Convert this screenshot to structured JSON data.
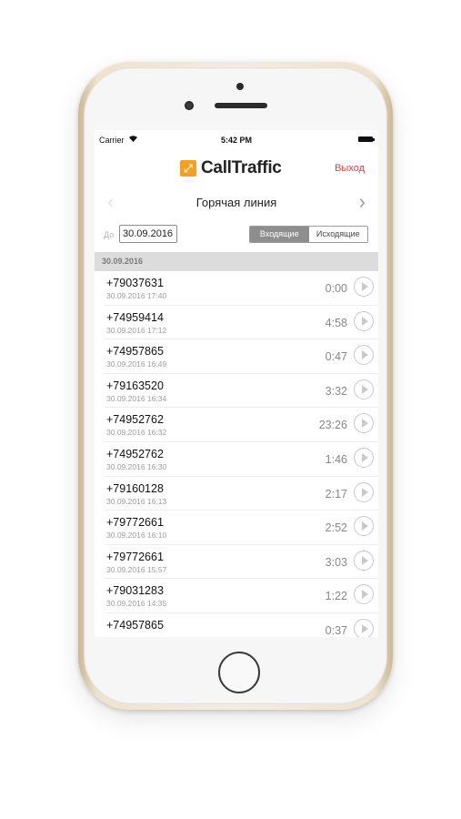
{
  "status_bar": {
    "carrier": "Carrier",
    "wifi_icon": "wifi-icon",
    "time": "5:42 PM",
    "battery_icon": "battery-icon"
  },
  "header": {
    "logo_text": "CallTraffic",
    "logo_color": "#f3a021",
    "logout_label": "Выход",
    "logout_color": "#e2413b"
  },
  "line_selector": {
    "title": "Горячая линия",
    "prev_icon": "chevron-left-icon",
    "next_icon": "chevron-right-icon"
  },
  "filter": {
    "date_prefix": "До",
    "date_value": "30.09.2016",
    "tabs": [
      {
        "label": "Входящие",
        "active": true
      },
      {
        "label": "Исходящие",
        "active": false
      }
    ]
  },
  "section": {
    "date": "30.09.2016"
  },
  "calls": [
    {
      "number": "+79037631",
      "datetime": "30.09.2016 17:40",
      "duration": "0:00"
    },
    {
      "number": "+74959414",
      "datetime": "30.09.2016 17:12",
      "duration": "4:58"
    },
    {
      "number": "+74957865",
      "datetime": "30.09.2016 16:49",
      "duration": "0:47"
    },
    {
      "number": "+79163520",
      "datetime": "30.09.2016 16:34",
      "duration": "3:32"
    },
    {
      "number": "+74952762",
      "datetime": "30.09.2016 16:32",
      "duration": "23:26"
    },
    {
      "number": "+74952762",
      "datetime": "30.09.2016 16:30",
      "duration": "1:46"
    },
    {
      "number": "+79160128",
      "datetime": "30.09.2016 16:13",
      "duration": "2:17"
    },
    {
      "number": "+79772661",
      "datetime": "30.09.2016 16:10",
      "duration": "2:52"
    },
    {
      "number": "+79772661",
      "datetime": "30.09.2016 15:57",
      "duration": "3:03"
    },
    {
      "number": "+79031283",
      "datetime": "30.09.2016 14:35",
      "duration": "1:22"
    },
    {
      "number": "+74957865",
      "datetime": "",
      "duration": "0:37"
    }
  ]
}
